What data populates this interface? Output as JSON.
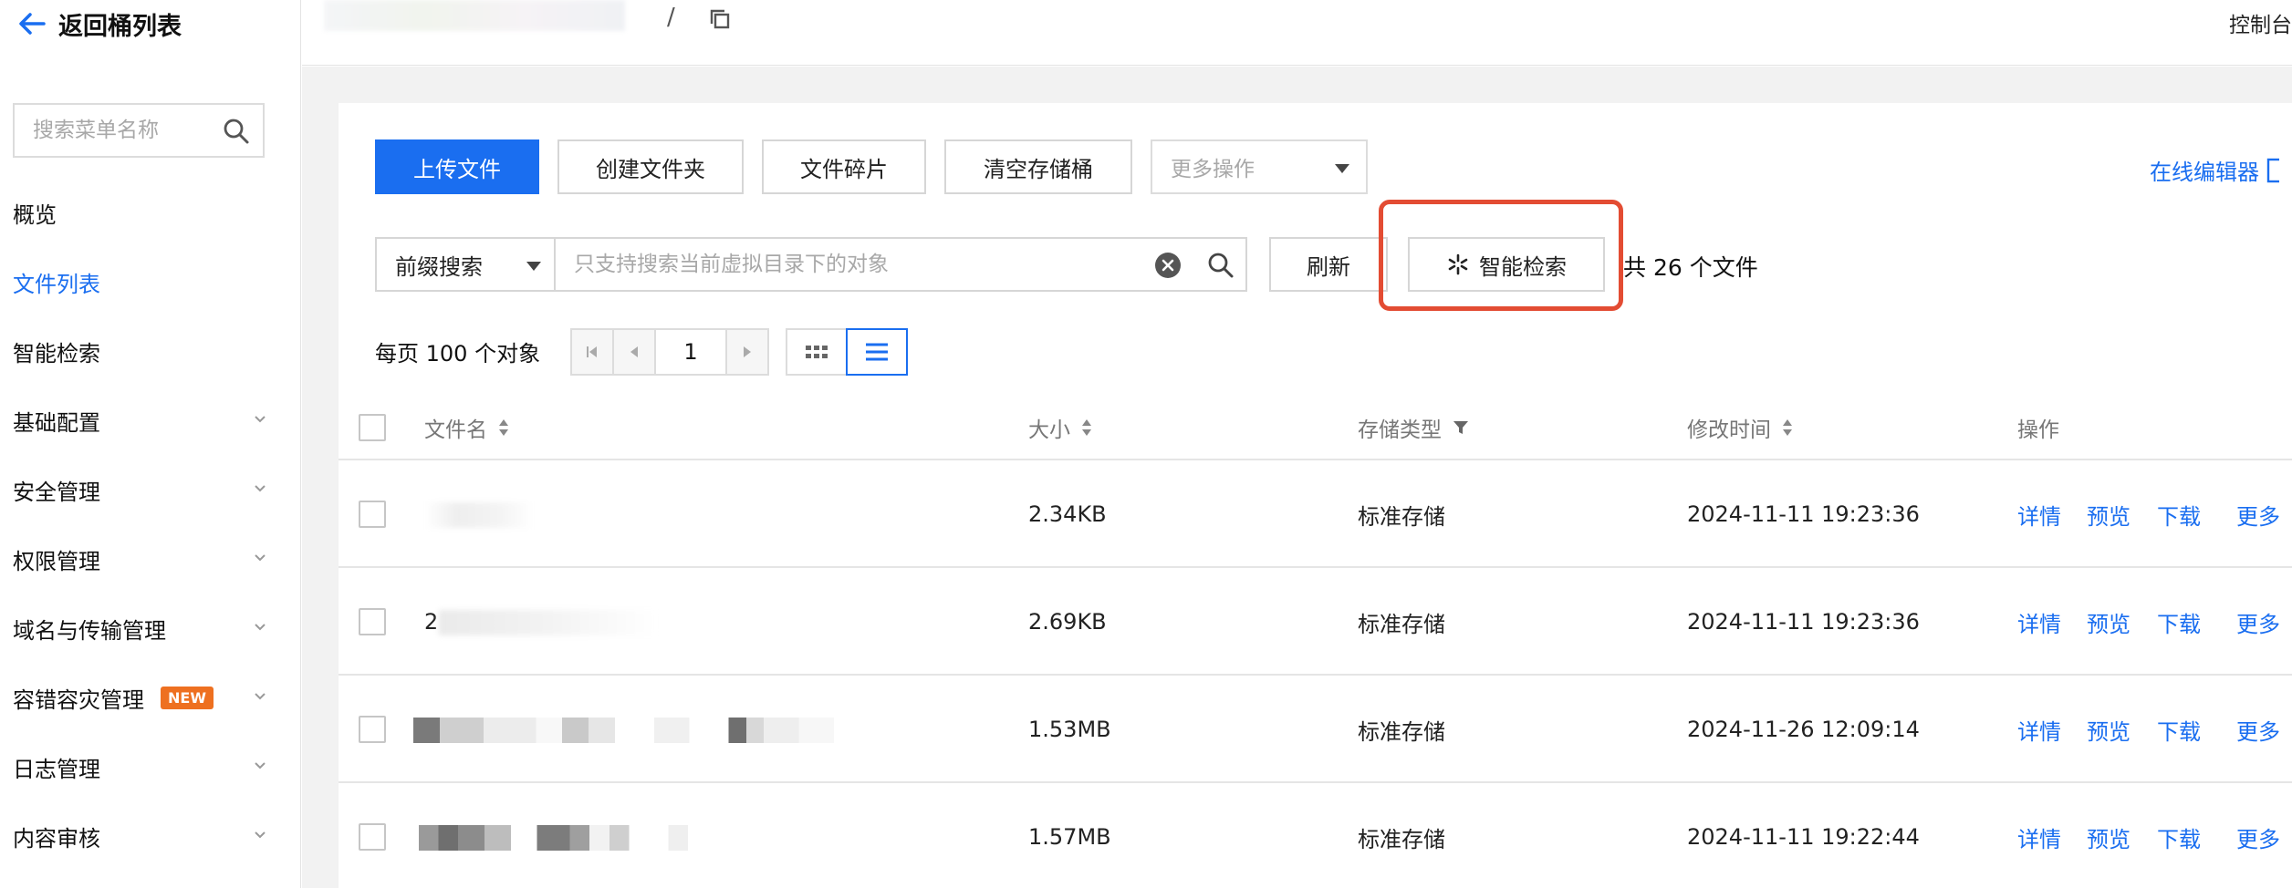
{
  "sidebar": {
    "back_label": "返回桶列表",
    "search_placeholder": "搜索菜单名称",
    "items": [
      {
        "label": "概览"
      },
      {
        "label": "文件列表"
      },
      {
        "label": "智能检索"
      },
      {
        "label": "基础配置"
      },
      {
        "label": "安全管理"
      },
      {
        "label": "权限管理"
      },
      {
        "label": "域名与传输管理"
      },
      {
        "label": "容错容灾管理",
        "badge": "NEW"
      },
      {
        "label": "日志管理"
      },
      {
        "label": "内容审核"
      }
    ]
  },
  "topbar": {
    "separator": "/",
    "console_label": "控制台"
  },
  "toolbar": {
    "upload": "上传文件",
    "create_folder": "创建文件夹",
    "fragments": "文件碎片",
    "clear_bucket": "清空存储桶",
    "more_ops": "更多操作",
    "online_editor": "在线编辑器"
  },
  "search": {
    "mode": "前缀搜索",
    "placeholder": "只支持搜索当前虚拟目录下的对象",
    "refresh": "刷新",
    "smart_search": "智能检索",
    "total": "共 26 个文件"
  },
  "pagination": {
    "per_page": "每页 100 个对象",
    "page": "1"
  },
  "table": {
    "headers": {
      "name": "文件名",
      "size": "大小",
      "storage": "存储类型",
      "modified": "修改时间",
      "actions": "操作"
    },
    "rows": [
      {
        "name": "",
        "size": "2.34KB",
        "storage": "标准存储",
        "modified": "2024-11-11 19:23:36"
      },
      {
        "name": "2",
        "size": "2.69KB",
        "storage": "标准存储",
        "modified": "2024-11-11 19:23:36"
      },
      {
        "name": "",
        "size": "1.53MB",
        "storage": "标准存储",
        "modified": "2024-11-26 12:09:14"
      },
      {
        "name": "",
        "size": "1.57MB",
        "storage": "标准存储",
        "modified": "2024-11-11 19:22:44"
      }
    ],
    "actions": {
      "detail": "详情",
      "preview": "预览",
      "download": "下载",
      "more": "更多"
    }
  },
  "colors": {
    "accent": "#1a6ef0",
    "highlight": "#e34c33",
    "badge": "#ee7020"
  }
}
